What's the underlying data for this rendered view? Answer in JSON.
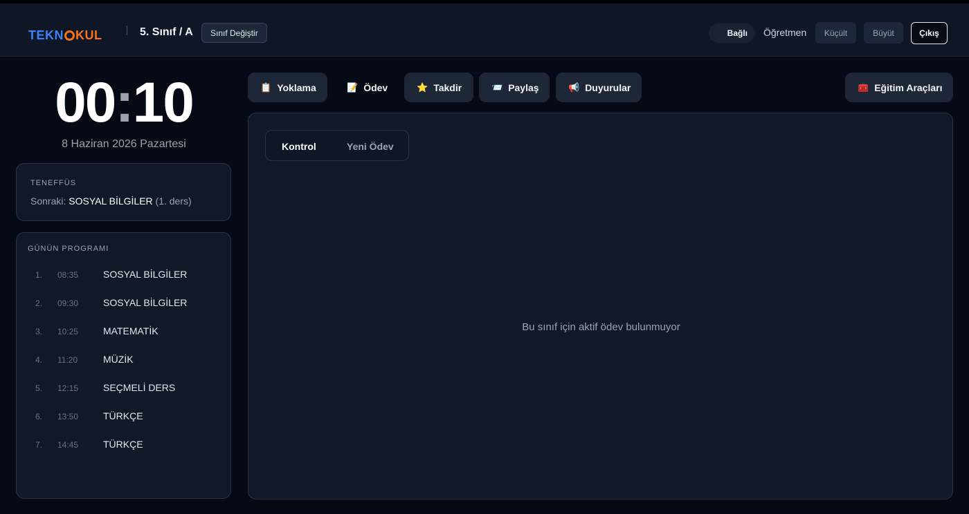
{
  "header": {
    "logo_part1": "TEKN",
    "logo_part2": "KUL",
    "class_name": "5. Sınıf / A",
    "change_class_label": "Sınıf Değiştir",
    "connection_status": "Bağlı",
    "role": "Öğretmen",
    "shrink_label": "Küçült",
    "enlarge_label": "Büyüt",
    "logout_label": "Çıkış"
  },
  "clock": {
    "hours": "00",
    "minutes": "10",
    "date": "8 Haziran 2026 Pazartesi"
  },
  "break_card": {
    "title": "TENEFFÜS",
    "next_prefix": "Sonraki:",
    "next_subject": "SOSYAL BİLGİLER",
    "next_suffix": "(1. ders)"
  },
  "program": {
    "title": "GÜNÜN PROGRAMI",
    "items": [
      {
        "n": "1.",
        "time": "08:35",
        "subject": "SOSYAL BİLGİLER"
      },
      {
        "n": "2.",
        "time": "09:30",
        "subject": "SOSYAL BİLGİLER"
      },
      {
        "n": "3.",
        "time": "10:25",
        "subject": "MATEMATİK"
      },
      {
        "n": "4.",
        "time": "11:20",
        "subject": "MÜZİK"
      },
      {
        "n": "5.",
        "time": "12:15",
        "subject": "SEÇMELİ DERS"
      },
      {
        "n": "6.",
        "time": "13:50",
        "subject": "TÜRKÇE"
      },
      {
        "n": "7.",
        "time": "14:45",
        "subject": "TÜRKÇE"
      }
    ]
  },
  "tabs": {
    "attendance": "Yoklama",
    "homework": "Ödev",
    "praise": "Takdir",
    "share": "Paylaş",
    "announcements": "Duyurular",
    "tools": "Eğitim Araçları"
  },
  "icons": {
    "attendance": "📋",
    "homework": "📝",
    "praise": "⭐",
    "share": "📨",
    "announcements": "📢",
    "tools": "🧰"
  },
  "homework_panel": {
    "subtab_check": "Kontrol",
    "subtab_new": "Yeni Ödev",
    "empty_message": "Bu sınıf için aktif ödev bulunmuyor"
  }
}
